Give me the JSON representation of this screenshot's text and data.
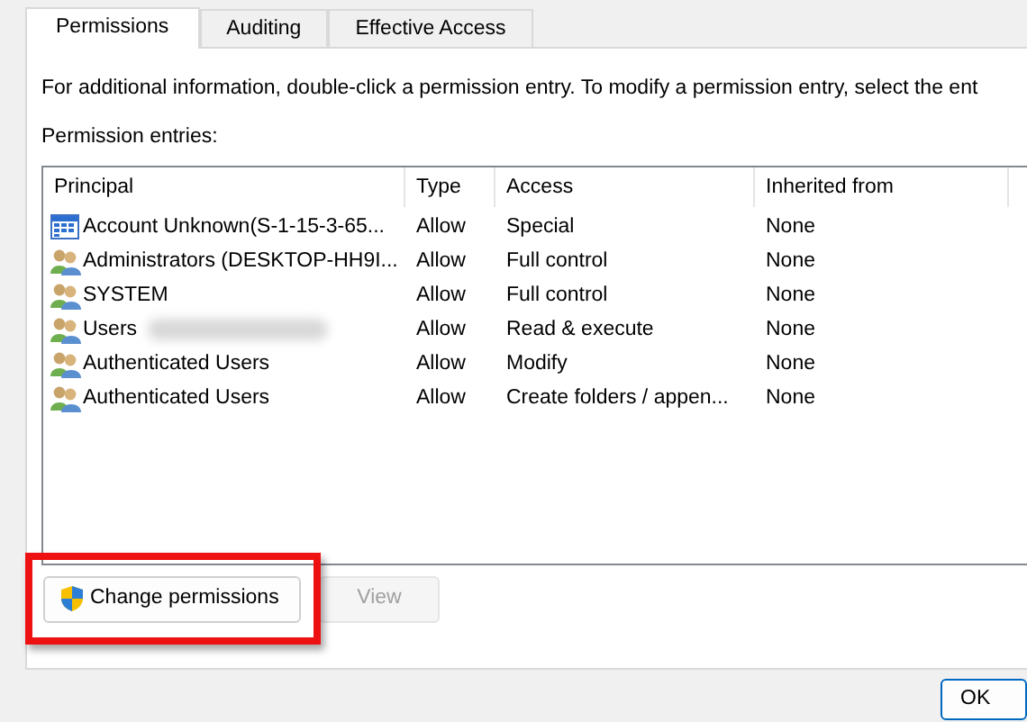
{
  "tabs": [
    {
      "label": "Permissions",
      "selected": true
    },
    {
      "label": "Auditing",
      "selected": false
    },
    {
      "label": "Effective Access",
      "selected": false
    }
  ],
  "info_text": "For additional information, double-click a permission entry. To modify a permission entry, select the ent",
  "entries_label": "Permission entries:",
  "table": {
    "columns": [
      "Principal",
      "Type",
      "Access",
      "Inherited from"
    ],
    "rows": [
      {
        "kind": "account",
        "principal": "Account Unknown(S-1-15-3-65...",
        "redacted": false,
        "type": "Allow",
        "access": "Special",
        "inherited_from": "None"
      },
      {
        "kind": "group",
        "principal": "Administrators (DESKTOP-HH9I...",
        "redacted": false,
        "type": "Allow",
        "access": "Full control",
        "inherited_from": "None"
      },
      {
        "kind": "group",
        "principal": "SYSTEM",
        "redacted": false,
        "type": "Allow",
        "access": "Full control",
        "inherited_from": "None"
      },
      {
        "kind": "group",
        "principal": "Users",
        "redacted": true,
        "type": "Allow",
        "access": "Read & execute",
        "inherited_from": "None"
      },
      {
        "kind": "group",
        "principal": "Authenticated Users",
        "redacted": false,
        "type": "Allow",
        "access": "Modify",
        "inherited_from": "None"
      },
      {
        "kind": "group",
        "principal": "Authenticated Users",
        "redacted": false,
        "type": "Allow",
        "access": "Create folders / appen...",
        "inherited_from": "None"
      }
    ]
  },
  "buttons": [
    {
      "label": "Change permissions",
      "shield": true,
      "disabled": false,
      "highlighted": true
    },
    {
      "label": "View",
      "shield": false,
      "disabled": true,
      "highlighted": false
    }
  ],
  "ok_button": "OK"
}
